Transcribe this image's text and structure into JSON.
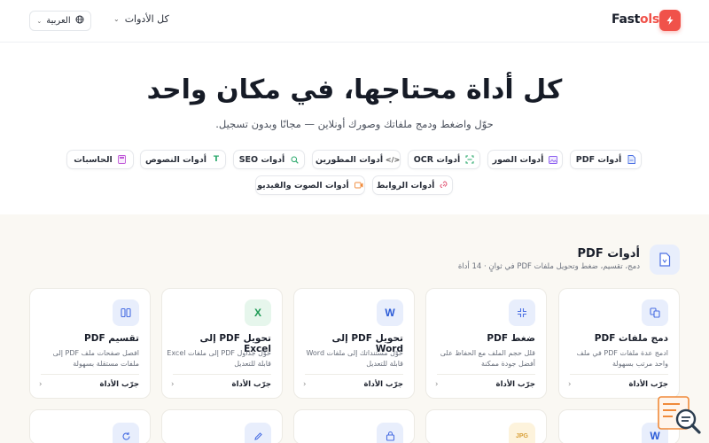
{
  "header": {
    "logo_main": "Fast",
    "logo_accent": "ols",
    "tools_menu_label": "كل الأدوات",
    "language_label": "العربية"
  },
  "hero": {
    "title": "كل أداة محتاجها، في مكان واحد",
    "subtitle": "حوّل واضغط ودمج ملفاتك وصورك أونلاين — مجانًا وبدون تسجيل."
  },
  "categories": [
    {
      "label": "أدوات PDF",
      "icon": "pdf-file-icon",
      "color": "#4a6fe3"
    },
    {
      "label": "أدوات الصور",
      "icon": "image-icon",
      "color": "#8a5cf0"
    },
    {
      "label": "أدوات OCR",
      "icon": "scan-icon",
      "color": "#2aa86b"
    },
    {
      "label": "أدوات المطورين",
      "icon": "code-icon",
      "color": "#555"
    },
    {
      "label": "أدوات SEO",
      "icon": "search-icon",
      "color": "#2aa86b"
    },
    {
      "label": "أدوات النصوص",
      "icon": "text-icon",
      "color": "#2aa86b"
    },
    {
      "label": "الحاسبات",
      "icon": "calculator-icon",
      "color": "#c058d8"
    },
    {
      "label": "أدوات الروابط",
      "icon": "link-icon",
      "color": "#e25a78"
    },
    {
      "label": "أدوات الصوت والفيديو",
      "icon": "video-icon",
      "color": "#f08a3a"
    }
  ],
  "section": {
    "title": "أدوات PDF",
    "subtitle": "دمج، تقسيم، ضغط وتحويل ملفات PDF في ثوانٍ · 14 أداة"
  },
  "tools": [
    {
      "title": "دمج ملفات PDF",
      "desc": "ادمج عدة ملفات PDF في ملف واحد مرتب بسهولة",
      "try": "جرّب الأداة",
      "icon": "merge-icon",
      "bg": "#e8eefc",
      "fg": "#4a6fe3"
    },
    {
      "title": "ضغط PDF",
      "desc": "قلل حجم الملف مع الحفاظ على أفضل جودة ممكنة",
      "try": "جرّب الأداة",
      "icon": "compress-icon",
      "bg": "#e8eefc",
      "fg": "#4a6fe3"
    },
    {
      "title": "تحويل PDF إلى Word",
      "desc": "حوّل مستنداتك إلى ملفات Word قابلة للتعديل",
      "try": "جرّب الأداة",
      "icon": "word-icon",
      "bg": "#e8eefc",
      "fg": "#2b5bd7",
      "glyph": "W"
    },
    {
      "title": "تحويل PDF إلى Excel",
      "desc": "حوّل جداول PDF إلى ملفات Excel قابلة للتعديل",
      "try": "جرّب الأداة",
      "icon": "excel-icon",
      "bg": "#e6f6ec",
      "fg": "#1f9a55",
      "glyph": "X"
    },
    {
      "title": "تقسيم PDF",
      "desc": "افصل صفحات ملف PDF إلى ملفات مستقلة بسهولة",
      "try": "جرّب الأداة",
      "icon": "split-icon",
      "bg": "#e8eefc",
      "fg": "#4a6fe3"
    }
  ],
  "tools_row2": [
    {
      "icon": "word-icon",
      "bg": "#e8eefc",
      "fg": "#2b5bd7",
      "glyph": "W"
    },
    {
      "icon": "jpg-icon",
      "bg": "#fdf3dc",
      "fg": "#d9a13a",
      "glyph": "JPG"
    },
    {
      "icon": "lock-icon",
      "bg": "#e8eefc",
      "fg": "#4a6fe3"
    },
    {
      "icon": "edit-icon",
      "bg": "#e8eefc",
      "fg": "#4a6fe3"
    },
    {
      "icon": "rotate-icon",
      "bg": "#e8eefc",
      "fg": "#4a6fe3"
    }
  ]
}
